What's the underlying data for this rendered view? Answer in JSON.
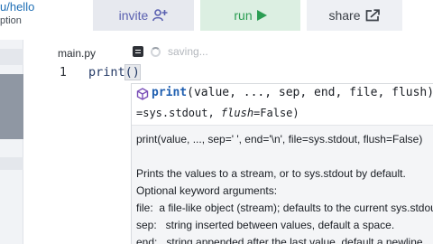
{
  "header": {
    "repo_path": "u/hello",
    "repo_desc": "ption",
    "invite_label": "invite",
    "run_label": "run",
    "share_label": "share"
  },
  "editor": {
    "file_tab": "main.py",
    "save_status": "saving...",
    "line_number": "1",
    "code_name": "print",
    "code_parens": "()"
  },
  "signature": {
    "name": "print",
    "params": "(value, ..., sep, end, file, flush)",
    "line2_prefix": "=sys.stdout, ",
    "line2_flush": "flush",
    "line2_suffix": "=False)"
  },
  "docs": {
    "signature_line": "print(value, ..., sep=' ', end='\\n', file=sys.stdout, flush=False)",
    "summary": "Prints the values to a stream, or to sys.stdout by default.",
    "optional_heading": "Optional keyword arguments:",
    "file_arg": "file:  a file-like object (stream); defaults to the current sys.stdout.",
    "sep_arg": "sep:   string inserted between values, default a space.",
    "end_arg": "end:   string appended after the last value, default a newline."
  },
  "colors": {
    "invite_bg": "#e7e9ef",
    "run_bg": "#dcefe2",
    "share_bg": "#eef0f4",
    "link": "#1f6fb5",
    "popup_bg": "#f4f5f7"
  },
  "icons": {
    "invite": "add-user-icon",
    "run": "play-icon",
    "share": "share-icon",
    "file": "file-icon",
    "signature": "function-cube-icon"
  }
}
